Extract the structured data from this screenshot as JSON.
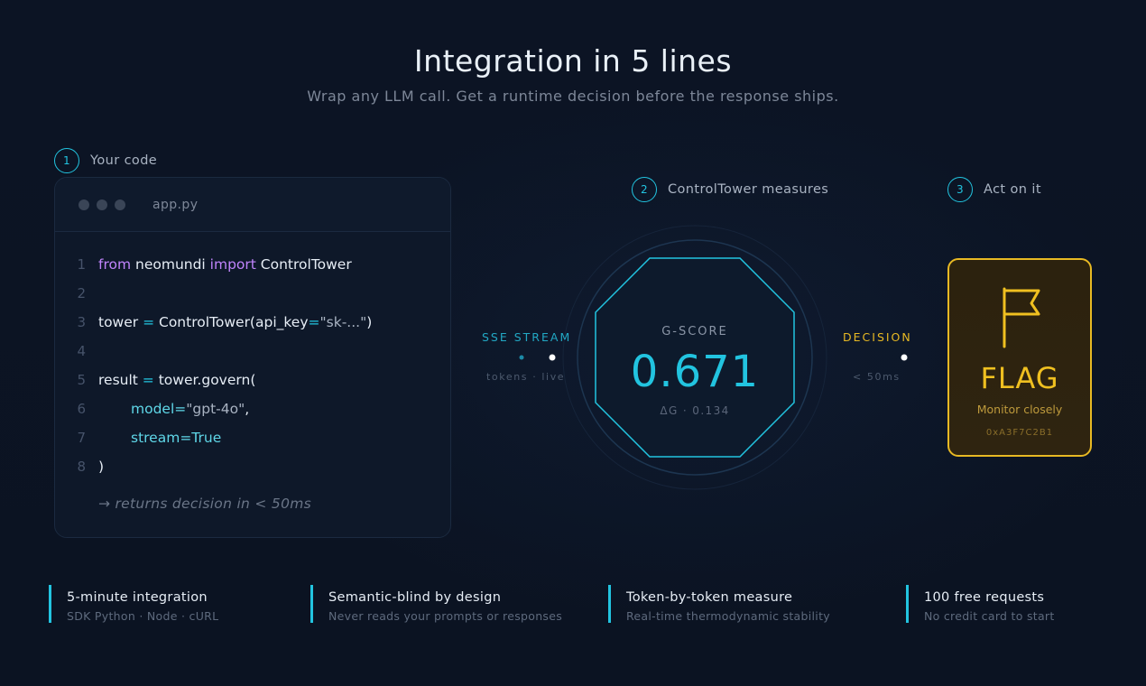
{
  "header": {
    "title": "Integration in 5 lines",
    "subtitle": "Wrap any LLM call. Get a runtime decision before the response ships."
  },
  "steps": [
    {
      "num": "1",
      "label": "Your code"
    },
    {
      "num": "2",
      "label": "ControlTower measures"
    },
    {
      "num": "3",
      "label": "Act on it"
    }
  ],
  "code": {
    "filename": "app.py",
    "line_numbers": [
      "1",
      "2",
      "3",
      "4",
      "5",
      "6",
      "7",
      "8"
    ],
    "l1": {
      "kw1": "from",
      "mod": " neomundi ",
      "kw2": "import",
      "cls": " ControlTower"
    },
    "l3": {
      "var": "tower ",
      "eq": "=",
      "call": " ControlTower(api_key",
      "eq2": "=",
      "str": "\"sk-...\"",
      "close": ")"
    },
    "l5": {
      "var": "result ",
      "eq": "=",
      "call": " tower.govern("
    },
    "l6": {
      "arg": "model=",
      "str": "\"gpt-4o\"",
      "tail": ","
    },
    "l7": {
      "arg": "stream=True"
    },
    "l8": {
      "close": ")"
    },
    "note": "→ returns decision in < 50ms"
  },
  "stream": {
    "label": "SSE STREAM",
    "sub": "tokens · live"
  },
  "gauge": {
    "label": "G-SCORE",
    "value": "0.671",
    "delta": "ΔG · 0.134"
  },
  "decision": {
    "label": "DECISION",
    "sub": "< 50ms"
  },
  "verdict": {
    "word": "FLAG",
    "sub": "Monitor closely",
    "hash": "0xA3F7C2B1",
    "icon": "flag-icon"
  },
  "features": [
    {
      "title": "5-minute integration",
      "sub": "SDK Python · Node · cURL"
    },
    {
      "title": "Semantic-blind by design",
      "sub": "Never reads your prompts or responses"
    },
    {
      "title": "Token-by-token measure",
      "sub": "Real-time thermodynamic stability"
    },
    {
      "title": "100 free requests",
      "sub": "No credit card to start"
    }
  ],
  "colors": {
    "accent": "#22c4e0",
    "warning": "#e8b923",
    "keyword": "#c084fc",
    "background": "#0b1322"
  }
}
